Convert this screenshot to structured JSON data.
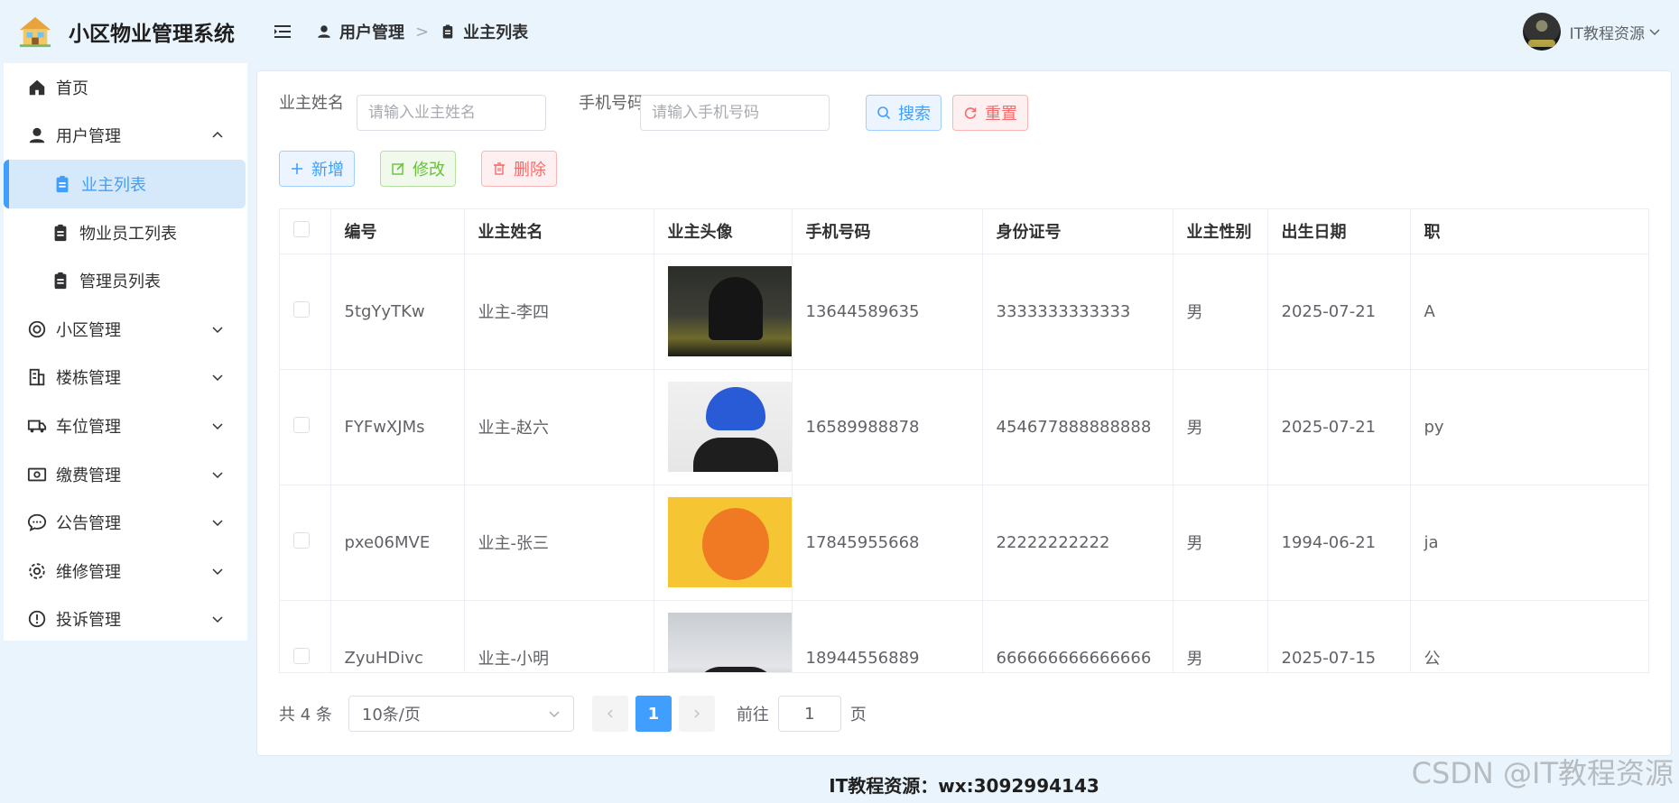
{
  "app": {
    "title": "小区物业管理系统"
  },
  "sidebar": {
    "items": [
      {
        "label": "首页",
        "icon": "home-icon"
      },
      {
        "label": "用户管理",
        "icon": "user-icon",
        "expanded": true
      },
      {
        "label": "业主列表",
        "icon": "clipboard-icon",
        "active": true
      },
      {
        "label": "物业员工列表",
        "icon": "clipboard-icon"
      },
      {
        "label": "管理员列表",
        "icon": "clipboard-icon"
      },
      {
        "label": "小区管理",
        "icon": "lifebuoy-icon"
      },
      {
        "label": "楼栋管理",
        "icon": "building-icon"
      },
      {
        "label": "车位管理",
        "icon": "truck-icon"
      },
      {
        "label": "缴费管理",
        "icon": "money-icon"
      },
      {
        "label": "公告管理",
        "icon": "chat-icon"
      },
      {
        "label": "维修管理",
        "icon": "gear-icon"
      },
      {
        "label": "投诉管理",
        "icon": "warning-icon"
      }
    ]
  },
  "header": {
    "breadcrumb": [
      "用户管理",
      "业主列表"
    ],
    "user_name": "IT教程资源"
  },
  "search": {
    "owner_name_label": "业主姓名",
    "owner_name_placeholder": "请输入业主姓名",
    "owner_name_value": "",
    "phone_label": "手机号码",
    "phone_placeholder": "请输入手机号码",
    "phone_value": "",
    "search_button": "搜索",
    "reset_button": "重置"
  },
  "toolbar": {
    "add": "新增",
    "edit": "修改",
    "delete": "删除"
  },
  "table": {
    "columns": [
      "编号",
      "业主姓名",
      "业主头像",
      "手机号码",
      "身份证号",
      "业主性别",
      "出生日期",
      "职"
    ],
    "rows": [
      {
        "id": "5tgYyTKw",
        "name": "业主-李四",
        "phone": "13644589635",
        "id_card": "3333333333333",
        "gender": "男",
        "birth": "2025-07-21",
        "extra": "A"
      },
      {
        "id": "FYFwXJMs",
        "name": "业主-赵六",
        "phone": "16589988878",
        "id_card": "454677888888888",
        "gender": "男",
        "birth": "2025-07-21",
        "extra": "py"
      },
      {
        "id": "pxe06MVE",
        "name": "业主-张三",
        "phone": "17845955668",
        "id_card": "22222222222",
        "gender": "男",
        "birth": "1994-06-21",
        "extra": "ja"
      },
      {
        "id": "ZyuHDivc",
        "name": "业主-小明",
        "phone": "18944556889",
        "id_card": "666666666666666",
        "gender": "男",
        "birth": "2025-07-15",
        "extra": "公"
      }
    ]
  },
  "pagination": {
    "total_text": "共 4 条",
    "page_size": "10条/页",
    "current_page": "1",
    "goto_label": "前往",
    "goto_value": "1",
    "page_unit": "页"
  },
  "footer": {
    "text": "IT教程资源：wx:3092994143"
  },
  "watermark": "CSDN @IT教程资源",
  "colors": {
    "primary": "#409eff",
    "danger": "#f56c6c",
    "success": "#67c23a",
    "background": "#e9f4fc"
  }
}
